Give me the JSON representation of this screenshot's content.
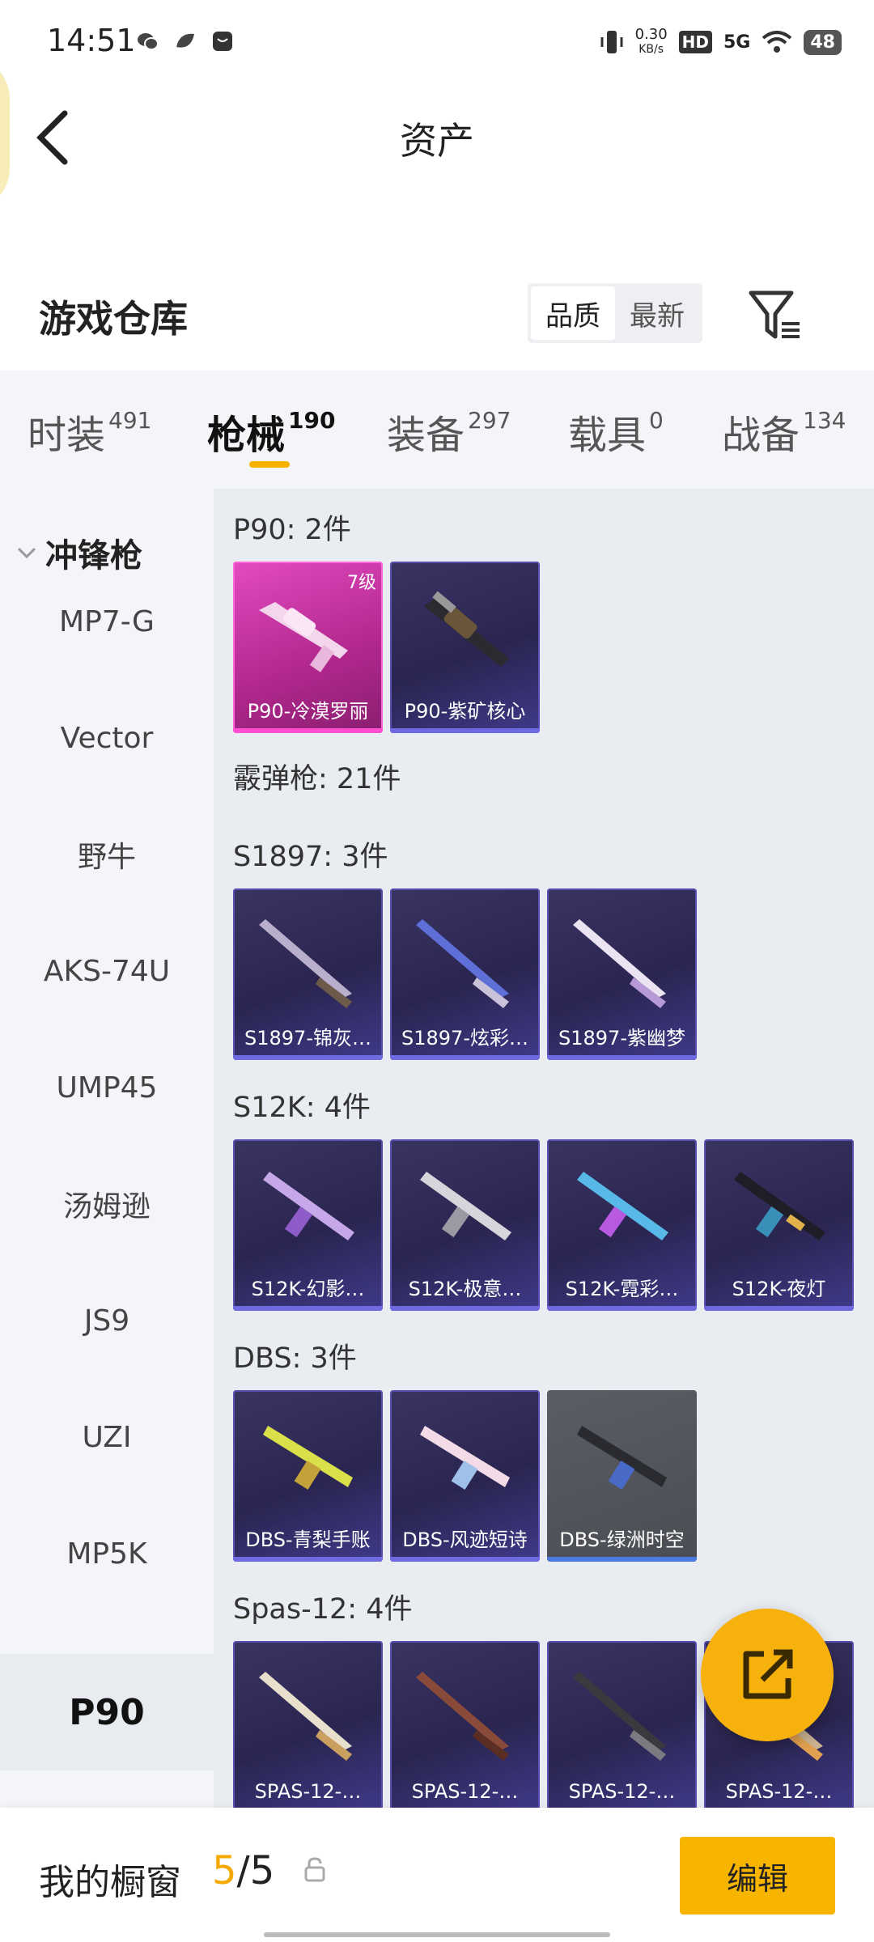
{
  "status_bar": {
    "time": "14:51",
    "net_speed_value": "0.30",
    "net_speed_unit": "KB/s",
    "hd": "HD",
    "network": "5G",
    "battery": "48"
  },
  "header": {
    "title": "资产"
  },
  "warehouse": {
    "title": "游戏仓库",
    "sort_quality": "品质",
    "sort_latest": "最新"
  },
  "tabs": [
    {
      "label": "时装",
      "count": "491"
    },
    {
      "label": "枪械",
      "count": "190"
    },
    {
      "label": "装备",
      "count": "297"
    },
    {
      "label": "载具",
      "count": "0"
    },
    {
      "label": "战备",
      "count": "134"
    }
  ],
  "sidebar": {
    "category": "冲锋枪",
    "items": [
      "MP7-G",
      "Vector",
      "野牛",
      "AKS-74U",
      "UMP45",
      "汤姆逊",
      "JS9",
      "UZI",
      "MP5K",
      "P90"
    ]
  },
  "sections": [
    {
      "title": "P90: 2件",
      "items": [
        {
          "name": "P90-冷漠罗丽",
          "level": "7级"
        },
        {
          "name": "P90-紫矿核心"
        }
      ]
    },
    {
      "title": "霰弹枪: 21件",
      "items": []
    },
    {
      "title": "S1897: 3件",
      "items": [
        {
          "name": "S1897-锦灰…"
        },
        {
          "name": "S1897-炫彩…"
        },
        {
          "name": "S1897-紫幽梦"
        }
      ]
    },
    {
      "title": "S12K: 4件",
      "items": [
        {
          "name": "S12K-幻影…"
        },
        {
          "name": "S12K-极意…"
        },
        {
          "name": "S12K-霓彩…"
        },
        {
          "name": "S12K-夜灯"
        }
      ]
    },
    {
      "title": "DBS: 3件",
      "items": [
        {
          "name": "DBS-青梨手账"
        },
        {
          "name": "DBS-风迹短诗"
        },
        {
          "name": "DBS-绿洲时空"
        }
      ]
    },
    {
      "title": "Spas-12: 4件",
      "items": [
        {
          "name": "SPAS-12-…"
        },
        {
          "name": "SPAS-12-…"
        },
        {
          "name": "SPAS-12-…"
        },
        {
          "name": "SPAS-12-…"
        }
      ]
    }
  ],
  "bottom": {
    "showcase_label": "我的橱窗",
    "showcase_current": "5",
    "showcase_total": "/5",
    "edit": "编辑"
  },
  "colors": {
    "accent": "#f7b500",
    "tab_underline": "#f5b300",
    "card_purple": "#2a2550",
    "card_pink": "#d23aa8"
  }
}
